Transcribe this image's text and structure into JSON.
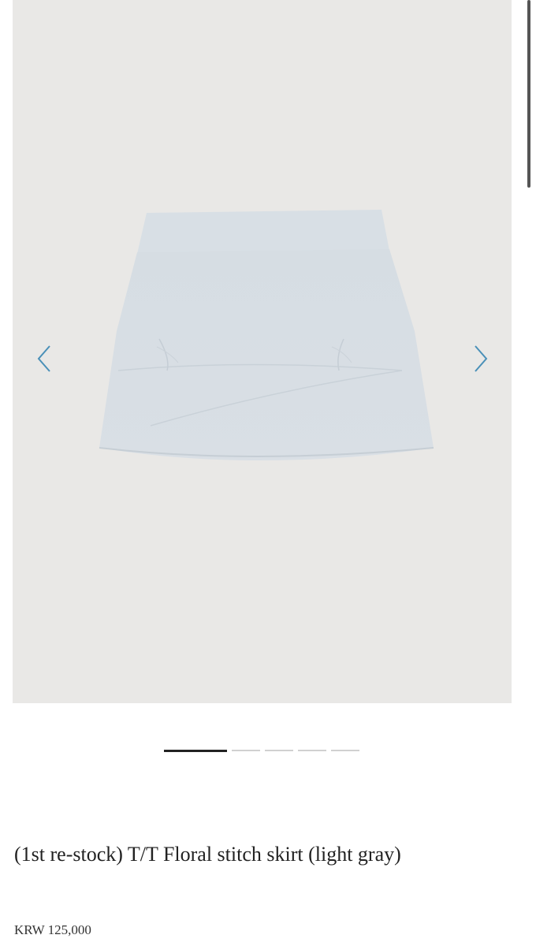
{
  "gallery": {
    "image_name": "product-skirt-image",
    "slide_count": 5,
    "active_slide": 1,
    "prev_icon": "chevron-left-icon",
    "next_icon": "chevron-right-icon",
    "arrow_color": "#4a90b8",
    "background": "#e9e8e6"
  },
  "product": {
    "title": "(1st re-stock) T/T Floral stitch skirt (light gray)",
    "price": "KRW 125,000"
  }
}
